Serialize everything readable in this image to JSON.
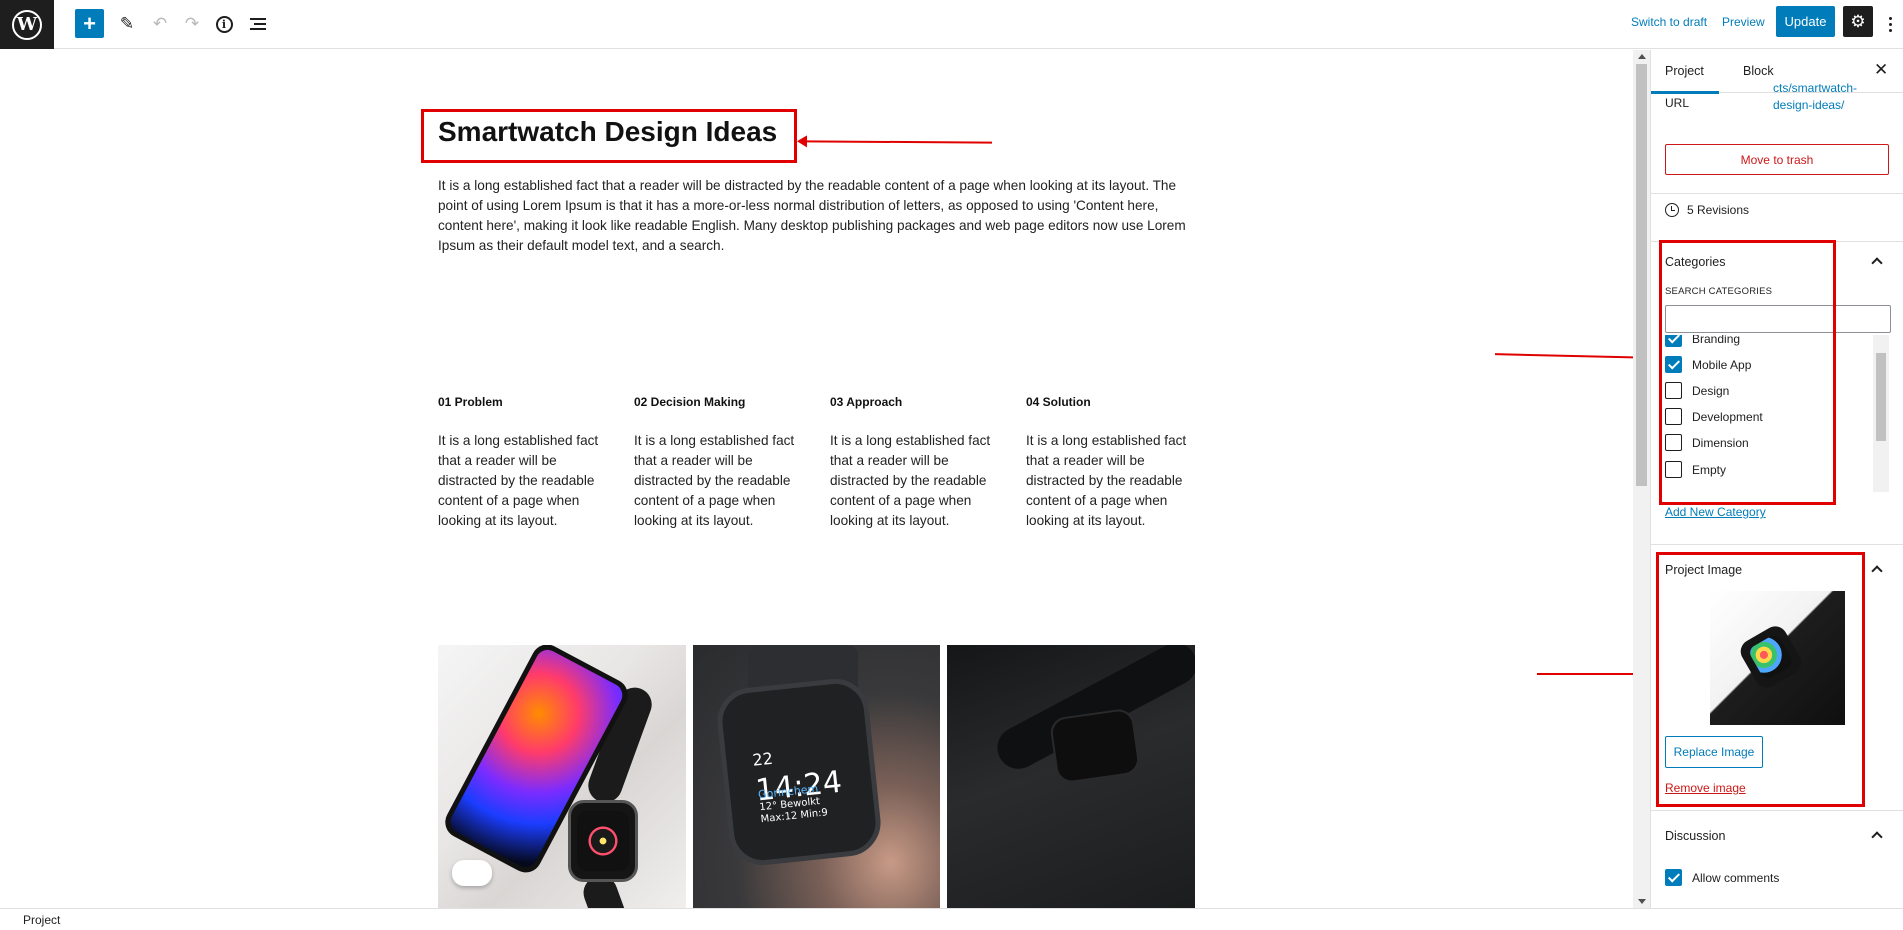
{
  "toolbar": {
    "switch_to_draft": "Switch to draft",
    "preview": "Preview",
    "update": "Update"
  },
  "post": {
    "title": "Smartwatch Design Ideas",
    "intro": "It is a long established fact that a reader will be distracted by the readable content of a page when looking at its layout. The point of using Lorem Ipsum is that it has a more-or-less normal distribution of letters, as opposed to using 'Content here, content here', making it look like readable English. Many desktop publishing packages and web page editors now use Lorem Ipsum as their default model text, and a search.",
    "columns": [
      {
        "heading": "01 Problem",
        "text": "It is a long established fact that a reader will be distracted by the readable content of a page when looking at its layout."
      },
      {
        "heading": "02 Decision Making",
        "text": "It is a long established fact that a reader will be distracted by the readable content of a page when looking at its layout."
      },
      {
        "heading": "03 Approach",
        "text": "It is a long established fact that a reader will be distracted by the readable content of a page when looking at its layout."
      },
      {
        "heading": "04 Solution",
        "text": "It is a long established fact that a reader will be distracted by the readable content of a page when looking at its layout."
      }
    ],
    "watch_time": "14:24",
    "watch_date": "22",
    "watch_location": "Gorinchem",
    "watch_weather": "12° Bewolkt",
    "watch_max": "Max:12 Min:9"
  },
  "sidebar": {
    "tabs": [
      "Project",
      "Block"
    ],
    "url_label": "URL",
    "url_value": "cts/smartwatch-design-ideas/",
    "move_to_trash": "Move to trash",
    "revisions": "5 Revisions",
    "categories": {
      "title": "Categories",
      "search_label": "SEARCH CATEGORIES",
      "search_value": "",
      "items": [
        {
          "label": "Branding",
          "checked": true
        },
        {
          "label": "Mobile App",
          "checked": true
        },
        {
          "label": "Design",
          "checked": false
        },
        {
          "label": "Development",
          "checked": false
        },
        {
          "label": "Dimension",
          "checked": false
        },
        {
          "label": "Empty",
          "checked": false
        }
      ],
      "add_new": "Add New Category"
    },
    "project_image": {
      "title": "Project Image",
      "replace": "Replace Image",
      "remove": "Remove image"
    },
    "discussion": {
      "title": "Discussion",
      "allow_comments": "Allow comments",
      "allow_comments_checked": true
    }
  },
  "footer": {
    "breadcrumb": "Project"
  },
  "colors": {
    "accent": "#007cba",
    "annotation": "#e00000",
    "destructive": "#cc1818"
  }
}
